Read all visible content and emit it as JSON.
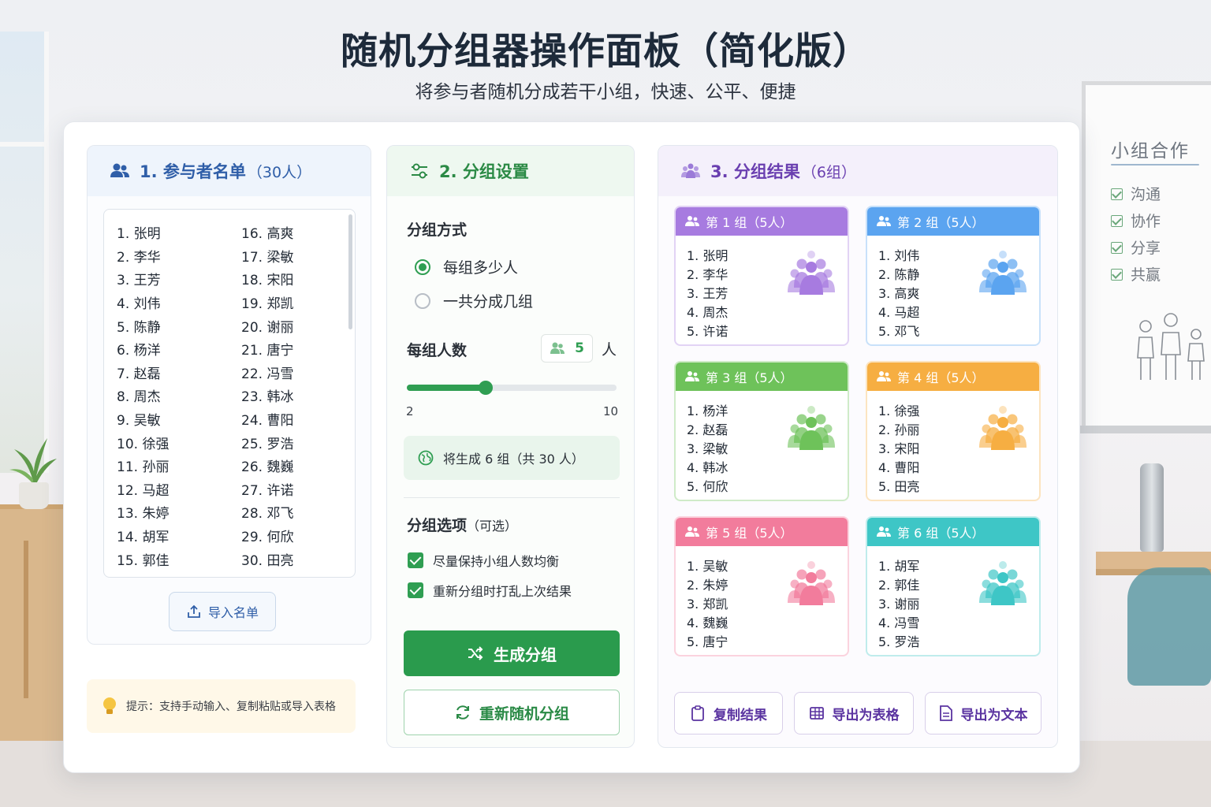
{
  "header": {
    "title": "随机分组器操作面板（简化版）",
    "subtitle": "将参与者随机分成若干小组，快速、公平、便捷"
  },
  "whiteboard": {
    "title": "小组合作",
    "items": [
      "沟通",
      "协作",
      "分享",
      "共赢"
    ]
  },
  "participants": {
    "heading": "1. 参与者名单",
    "count_label": "（30人）",
    "names": [
      "1. 张明",
      "2. 李华",
      "3. 王芳",
      "4. 刘伟",
      "5. 陈静",
      "6. 杨洋",
      "7. 赵磊",
      "8. 周杰",
      "9. 吴敏",
      "10. 徐强",
      "11. 孙丽",
      "12. 马超",
      "13. 朱婷",
      "14. 胡军",
      "15. 郭佳",
      "16. 高爽",
      "17. 梁敏",
      "18. 宋阳",
      "19. 郑凯",
      "20. 谢丽",
      "21. 唐宁",
      "22. 冯雪",
      "23. 韩冰",
      "24. 曹阳",
      "25. 罗浩",
      "26. 魏巍",
      "27. 许诺",
      "28. 邓飞",
      "29. 何欣",
      "30. 田亮"
    ],
    "import_label": "导入名单",
    "tip": "提示：支持手动输入、复制粘贴或导入表格"
  },
  "settings": {
    "heading": "2. 分组设置",
    "mode_label": "分组方式",
    "mode_options": [
      "每组多少人",
      "一共分成几组"
    ],
    "selected_mode": 0,
    "size_label": "每组人数",
    "size_value": "5",
    "size_unit": "人",
    "slider": {
      "min": "2",
      "max": "10",
      "value": 5
    },
    "info": "将生成 6 组（共 30 人）",
    "options_label": "分组选项",
    "options_sub": "（可选）",
    "options": [
      "尽量保持小组人数均衡",
      "重新分组时打乱上次结果"
    ],
    "generate_label": "生成分组",
    "regenerate_label": "重新随机分组"
  },
  "results": {
    "heading": "3. 分组结果",
    "count_label": "（6组）",
    "groups": [
      {
        "title": "第 1 组（5人）",
        "color": "#a77be0",
        "members": [
          "1. 张明",
          "2. 李华",
          "3. 王芳",
          "4. 周杰",
          "5. 许诺"
        ]
      },
      {
        "title": "第 2 组（5人）",
        "color": "#5ba4f0",
        "members": [
          "1. 刘伟",
          "2. 陈静",
          "3. 高爽",
          "4. 马超",
          "5. 邓飞"
        ]
      },
      {
        "title": "第 3 组（5人）",
        "color": "#6ec25a",
        "members": [
          "1. 杨洋",
          "2. 赵磊",
          "3. 梁敏",
          "4. 韩冰",
          "5. 何欣"
        ]
      },
      {
        "title": "第 4 组（5人）",
        "color": "#f6ae42",
        "members": [
          "1. 徐强",
          "2. 孙丽",
          "3. 宋阳",
          "4. 曹阳",
          "5. 田亮"
        ]
      },
      {
        "title": "第 5 组（5人）",
        "color": "#f27c9c",
        "members": [
          "1. 吴敏",
          "2. 朱婷",
          "3. 郑凯",
          "4. 魏巍",
          "5. 唐宁"
        ]
      },
      {
        "title": "第 6 组（5人）",
        "color": "#3ec6c6",
        "members": [
          "1. 胡军",
          "2. 郭佳",
          "3. 谢丽",
          "4. 冯雪",
          "5. 罗浩"
        ]
      }
    ],
    "actions": [
      "复制结果",
      "导出为表格",
      "导出为文本"
    ]
  },
  "colors": {
    "blue_accent": "#2f5ea8",
    "green_accent": "#2a9b4d",
    "purple_accent": "#6a3fb0"
  }
}
